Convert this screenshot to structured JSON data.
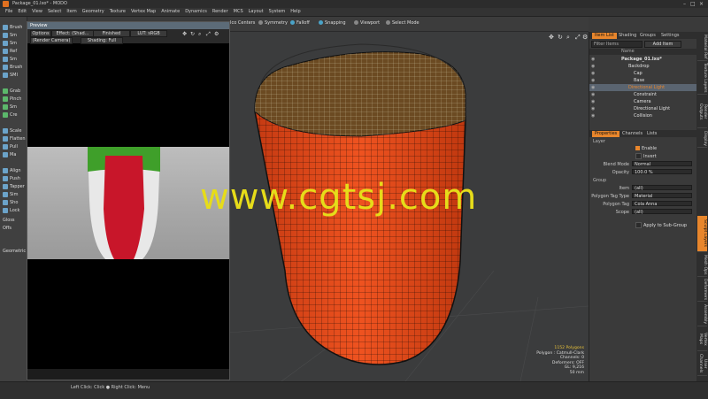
{
  "window": {
    "title": "Package_01.lxo* - MODO"
  },
  "menu": [
    "File",
    "Edit",
    "View",
    "Select",
    "Item",
    "Geometry",
    "Texture",
    "Vertex Map",
    "Animate",
    "Dynamics",
    "Render",
    "MCS",
    "Layout",
    "System",
    "Help"
  ],
  "left_tools": {
    "items": [
      "Brush",
      "Sm",
      "Sm",
      "Ref",
      "Sm",
      "Brush",
      "SMI",
      "Grab",
      "Pinch",
      "Sm",
      "Cre",
      "Scale",
      "Flatten",
      "Pull",
      "Ma",
      "Align",
      "Push",
      "Tapper",
      "Sim",
      "Sho",
      "Lock"
    ],
    "footer": [
      "Gloss",
      "Offs",
      "Geometric"
    ]
  },
  "preview": {
    "title": "Preview",
    "toolbar": {
      "options": "Options",
      "effect": "Effect: (Shad...",
      "finished": "Finished",
      "lut": "LUT: sRGB",
      "camera": "(Render Camera)",
      "shading": "Shading: Full"
    }
  },
  "viewport_toolbar": {
    "items": [
      "Ico Centers",
      "Symmetry",
      "Falloff",
      "Snapping",
      "Viewport",
      "Select Mode"
    ]
  },
  "viewport_info": [
    "1152 Polygons",
    "Polygon : Catmull-Clark",
    "Channels: 0",
    "Deformers: OFF",
    "GL: 9,216",
    "50 mm"
  ],
  "items_panel": {
    "tabs": [
      "Item List",
      "Shading",
      "Groups",
      "Settings"
    ],
    "active_tab": "Item List",
    "filter": "Filter Items",
    "add_item": "Add Item",
    "header": "Name",
    "rows": [
      {
        "name": "Package_01.lxo*",
        "indent": 0
      },
      {
        "name": "Backdrop",
        "indent": 1
      },
      {
        "name": "Cap",
        "indent": 2
      },
      {
        "name": "Base",
        "indent": 2
      },
      {
        "name": "Directional Light",
        "indent": 1
      },
      {
        "name": "Constraint",
        "indent": 2
      },
      {
        "name": "Camera",
        "indent": 2
      },
      {
        "name": "Directional Light",
        "indent": 2
      },
      {
        "name": "Collision",
        "indent": 2
      }
    ],
    "selected_index": 4
  },
  "properties_panel": {
    "tabs": [
      "Properties",
      "Channels",
      "Lists"
    ],
    "active_tab": "Properties",
    "section_layer": "Layer",
    "enable": "Enable",
    "invert": "Invert",
    "blend_mode_label": "Blend Mode",
    "blend_mode_value": "Normal",
    "opacity_label": "Opacity",
    "opacity_value": "100.0 %",
    "section_group": "Group",
    "item_label": "Item",
    "item_value": "(all)",
    "poly_tag_type_label": "Polygon Tag Type",
    "poly_tag_type_value": "Material",
    "poly_tag_label": "Polygon Tag",
    "poly_tag_value": "Cola Anna",
    "scope_label": "Scope",
    "scope_value": "(all)",
    "apply_sub": "Apply to Sub-Group"
  },
  "vertical_tabs": [
    "Material Ref",
    "Texture Layers",
    "Render Outputs",
    "Display",
    "Sculpt Layers",
    "Mesh Ops",
    "Deformers",
    "Assembly",
    "Vertex Maps",
    "User Channels",
    "Info"
  ],
  "status": {
    "hint": "Left Click: Click ● Right Click: Menu"
  },
  "watermark": "www.cgtsj.com",
  "colors": {
    "accent": "#e8862c",
    "mesh": "#e8491a",
    "watermark": "#e6dc1a",
    "preview_red": "#c8162a",
    "preview_green": "#3f9f2a"
  }
}
